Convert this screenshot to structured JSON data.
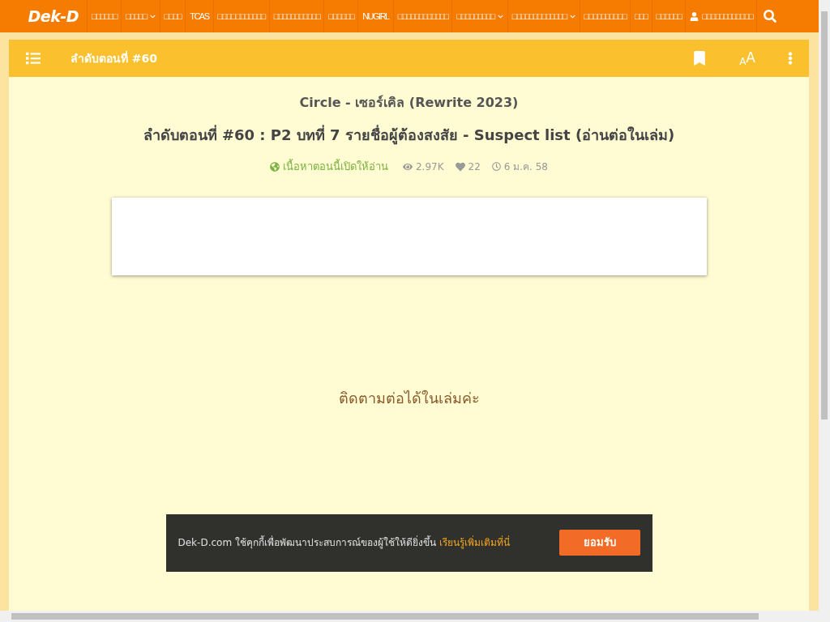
{
  "nav": {
    "logo": "Dek-D",
    "items": [
      {
        "label": "□□□□□□",
        "dropdown": false,
        "kind": "link"
      },
      {
        "label": "□□□□□",
        "dropdown": true,
        "kind": "link"
      },
      {
        "label": "□□□□",
        "dropdown": false,
        "kind": "link"
      },
      {
        "label": "TCAS",
        "dropdown": false,
        "kind": "link"
      },
      {
        "label": "□□□□ □□□□□□□",
        "dropdown": false,
        "kind": "link"
      },
      {
        "label": "□□□□□□□□□□□",
        "dropdown": false,
        "kind": "link"
      },
      {
        "label": "□□□□□□",
        "dropdown": false,
        "kind": "link"
      },
      {
        "label": "NUGIRL",
        "dropdown": false,
        "kind": "link"
      },
      {
        "label": "□□□□□□□□□□□□",
        "dropdown": false,
        "kind": "link"
      },
      {
        "label": "□□□□□□□□□",
        "dropdown": true,
        "kind": "link"
      },
      {
        "label": "□□□□□□□□□□□□□",
        "dropdown": true,
        "kind": "link"
      },
      {
        "label": "□□□□□□□□□□",
        "dropdown": false,
        "kind": "link"
      },
      {
        "label": "□□□",
        "dropdown": false,
        "kind": "link"
      },
      {
        "label": "□□□□□□",
        "dropdown": false,
        "kind": "link"
      },
      {
        "label": "□□□□□□□□□□□□",
        "dropdown": false,
        "kind": "account"
      }
    ]
  },
  "reader_bar": {
    "title": "ลำดับตอนที่ #60",
    "font_size_label_small": "A",
    "font_size_label_large": "A"
  },
  "story": {
    "title": "Circle - เซอร์เคิล (Rewrite 2023)",
    "chapter_title": "ลำดับตอนที่ #60 : P2 บทที่ 7 รายชื่อผู้ต้องสงสัย - Suspect list (อ่านต่อในเล่ม)",
    "access": "เนื้อหาตอนนี้เปิดให้อ่าน",
    "views": "2.97K",
    "likes": "22",
    "date": "6 ม.ค. 58"
  },
  "body_text": "ติดตามต่อได้ในเล่มค่ะ",
  "cookie_banner": {
    "text": "Dek-D.com ใช้คุกกี้เพื่อพัฒนาประสบการณ์ของผู้ใช้ให้ดียิ่งขึ้น",
    "link": "เรียนรู้เพิ่มเติมที่นี่",
    "button": "ยอมรับ"
  }
}
